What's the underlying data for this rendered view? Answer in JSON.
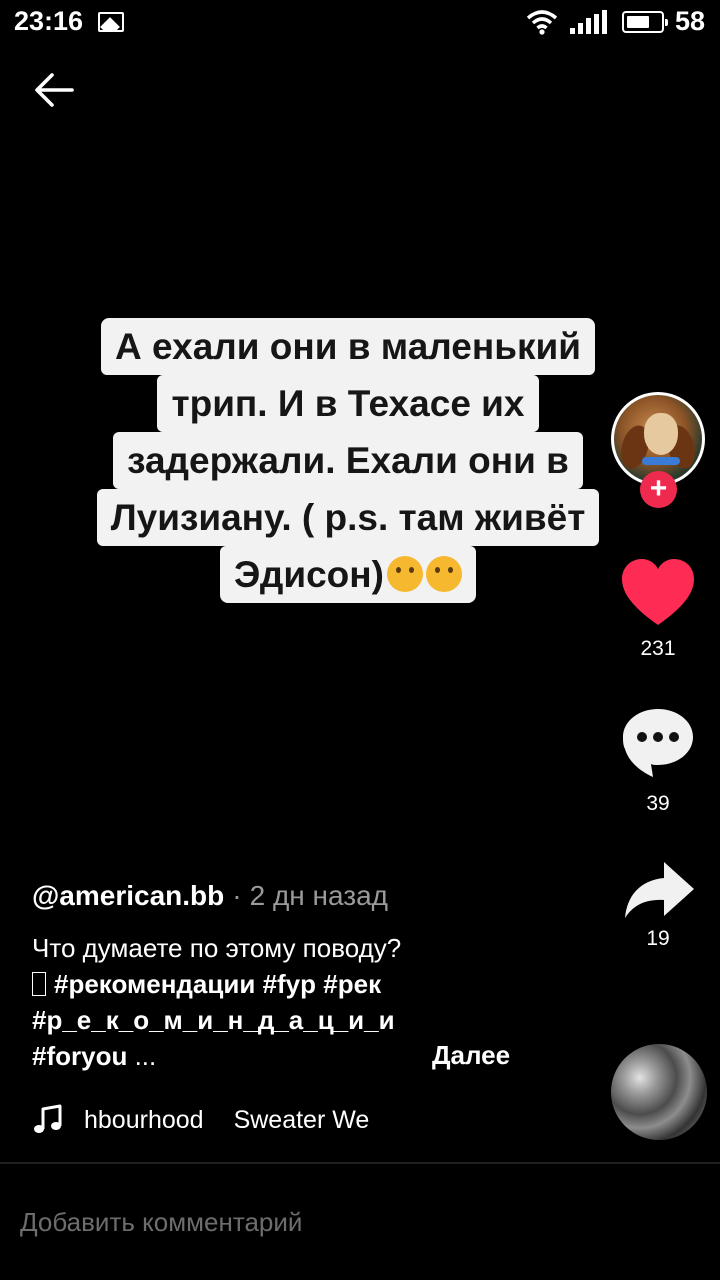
{
  "status_bar": {
    "time": "23:16",
    "battery": "58",
    "battery_fill": 0.58,
    "icons": [
      "gallery-icon",
      "wifi-icon",
      "signal-icon",
      "battery-icon"
    ]
  },
  "nav": {
    "back_icon": "arrow-left-icon"
  },
  "caption": {
    "lines": [
      "А ехали они в маленький",
      "трип. И в Техасе их",
      "задержали. Ехали они в",
      "Луизиану. ( p.s. там живёт",
      "Эдисон)"
    ],
    "emojis": [
      "🫢",
      "🤔"
    ]
  },
  "actions": {
    "follow_label": "+",
    "likes": "231",
    "comments": "39",
    "shares": "19",
    "like_color": "#fe2c55",
    "follow_color": "#ee2a4f"
  },
  "post": {
    "author": "@american.bb",
    "separator": "·",
    "time_ago": "2 дн назад",
    "description": "Что думаете по этому поводу?",
    "hashtags_line1": [
      "#рекомендации",
      "#fyp",
      "#рек"
    ],
    "hashtags_line2": "#р_е_к_о_м_и_н_д_а_ц_и_и",
    "hashtags_line3": "#foryou",
    "ellipsis": "...",
    "more_label": "Далее"
  },
  "music": {
    "part1": "hbourhood",
    "part2": "Sweater We"
  },
  "comment_input": {
    "placeholder": "Добавить комментарий"
  }
}
